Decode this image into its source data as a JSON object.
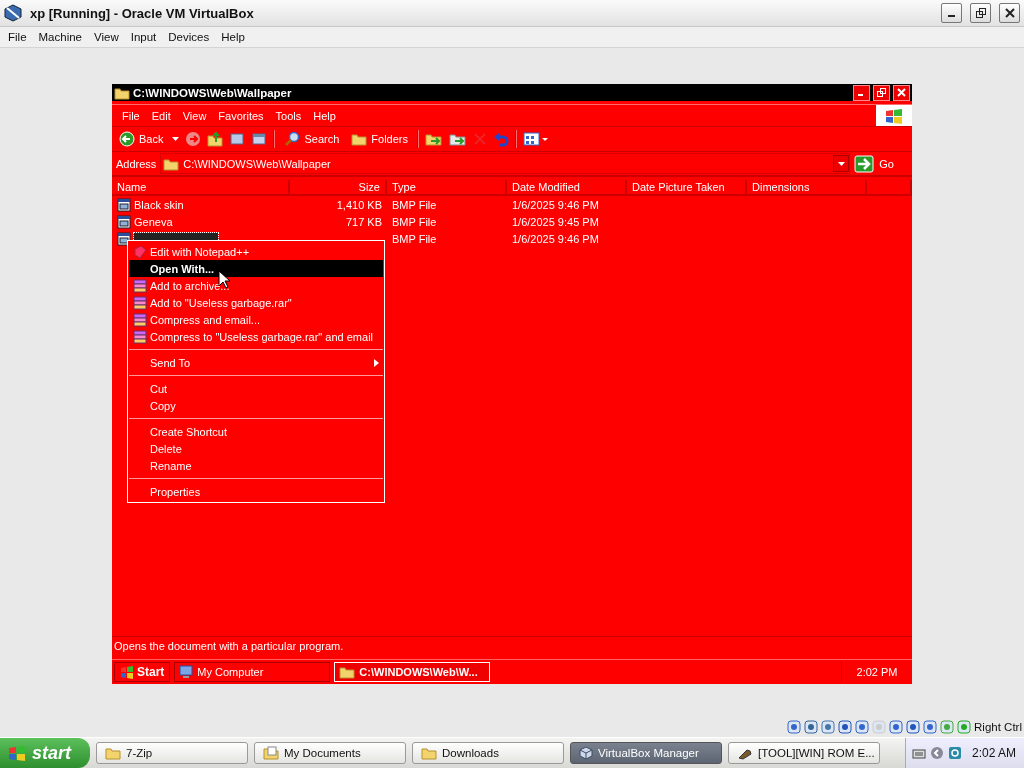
{
  "host_window": {
    "title": "xp [Running] - Oracle VM VirtualBox",
    "menu": [
      "File",
      "Machine",
      "View",
      "Input",
      "Devices",
      "Help"
    ]
  },
  "explorer": {
    "title": "C:\\WINDOWS\\Web\\Wallpaper",
    "menu": [
      "File",
      "Edit",
      "View",
      "Favorites",
      "Tools",
      "Help"
    ],
    "toolbar": [
      {
        "kind": "back",
        "label": "Back"
      },
      {
        "kind": "search",
        "label": "Search"
      },
      {
        "kind": "folders",
        "label": "Folders"
      }
    ],
    "address": {
      "label": "Address",
      "value": "C:\\WINDOWS\\Web\\Wallpaper",
      "go": "Go"
    },
    "columns": [
      "Name",
      "Size",
      "Type",
      "Date Modified",
      "Date Picture Taken",
      "Dimensions"
    ],
    "rows": [
      {
        "name": "Black skin",
        "size": "1,410 KB",
        "type": "BMP File",
        "modified": "1/6/2025 9:46 PM",
        "selected": false
      },
      {
        "name": "Geneva",
        "size": "717 KB",
        "type": "BMP File",
        "modified": "1/6/2025 9:45 PM",
        "selected": false
      },
      {
        "type": "BMP File",
        "modified": "1/6/2025 9:46 PM",
        "selected": true
      }
    ],
    "status": "Opens the document with a particular program."
  },
  "context_menu": {
    "items": [
      {
        "kind": "notepad",
        "label": "Edit with Notepad++",
        "selected": false,
        "default": false
      },
      {
        "kind": "plain",
        "label": "Open With...",
        "selected": true,
        "default": true
      },
      {
        "kind": "archive",
        "label": "Add to archive...",
        "selected": false,
        "default": false
      },
      {
        "kind": "archive",
        "label": "Add to \"Useless garbage.rar\"",
        "selected": false,
        "default": false
      },
      {
        "kind": "archive",
        "label": "Compress and email...",
        "selected": false,
        "default": false
      },
      {
        "kind": "archive",
        "label": "Compress to \"Useless garbage.rar\" and email",
        "selected": false,
        "default": false
      },
      {
        "kind": "separator"
      },
      {
        "kind": "submenu",
        "label": "Send To",
        "selected": false,
        "default": false
      },
      {
        "kind": "separator"
      },
      {
        "kind": "plain",
        "label": "Cut",
        "selected": false,
        "default": false
      },
      {
        "kind": "plain",
        "label": "Copy",
        "selected": false,
        "default": false
      },
      {
        "kind": "separator"
      },
      {
        "kind": "plain",
        "label": "Create Shortcut",
        "selected": false,
        "default": false
      },
      {
        "kind": "plain",
        "label": "Delete",
        "selected": false,
        "default": false
      },
      {
        "kind": "plain",
        "label": "Rename",
        "selected": false,
        "default": false
      },
      {
        "kind": "separator"
      },
      {
        "kind": "plain",
        "label": "Properties",
        "selected": false,
        "default": false
      }
    ]
  },
  "guest_taskbar": {
    "start": "Start",
    "tasks": [
      {
        "kind": "computer",
        "label": "My Computer",
        "selected": false
      },
      {
        "kind": "folder",
        "label": "C:\\WINDOWS\\Web\\W...",
        "selected": true
      }
    ],
    "clock": "2:02 PM"
  },
  "host_status": {
    "host_key": "Right Ctrl"
  },
  "host_taskbar": {
    "start": "start",
    "tasks": [
      {
        "kind": "folder",
        "label": "7-Zip",
        "selected": false
      },
      {
        "kind": "documents",
        "label": "My Documents",
        "selected": false
      },
      {
        "kind": "folder",
        "label": "Downloads",
        "selected": false
      },
      {
        "kind": "cube",
        "label": "VirtualBox Manager",
        "selected": true
      },
      {
        "kind": "tool",
        "label": "[TOOL][WIN] ROM E...",
        "selected": false
      }
    ],
    "clock": "2:02 AM"
  }
}
